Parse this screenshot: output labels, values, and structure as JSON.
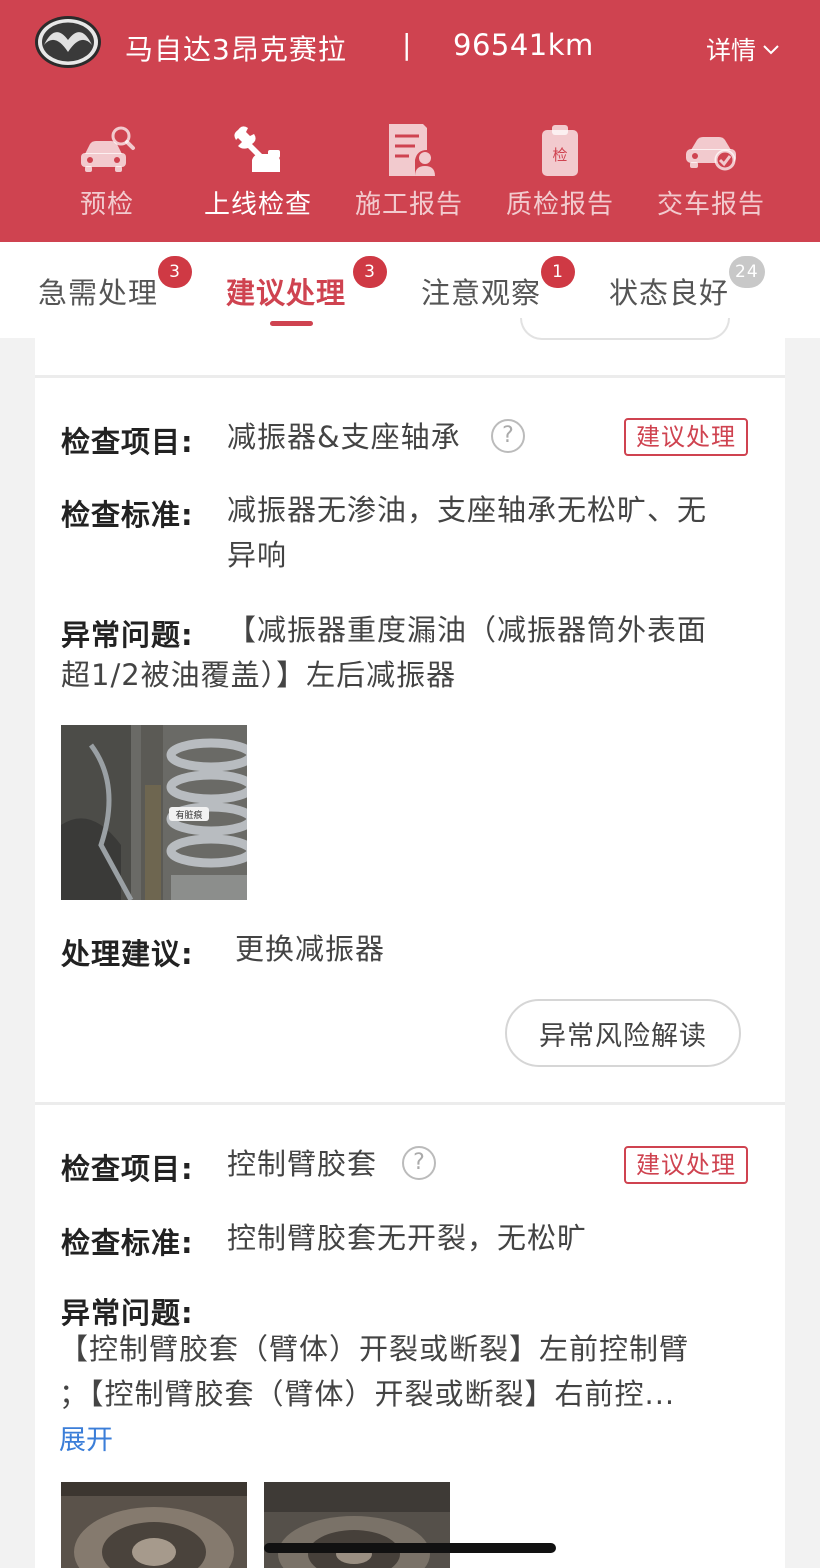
{
  "header": {
    "car_name": "马自达3昂克赛拉",
    "separator": "|",
    "mileage": "96541km",
    "detail": "详情",
    "bg_color": "#cf4350",
    "nav": [
      {
        "label": "预检",
        "icon": "car-search-icon"
      },
      {
        "label": "上线检查",
        "icon": "wrench-hand-icon"
      },
      {
        "label": "施工报告",
        "icon": "report-person-icon"
      },
      {
        "label": "质检报告",
        "icon": "clipboard-check-icon"
      },
      {
        "label": "交车报告",
        "icon": "car-check-icon"
      }
    ]
  },
  "tabs": [
    {
      "label": "急需处理",
      "count": "3"
    },
    {
      "label": "建议处理",
      "count": "3",
      "active": true
    },
    {
      "label": "注意观察",
      "count": "1"
    },
    {
      "label": "状态良好",
      "count": "24"
    }
  ],
  "labels": {
    "item": "检查项目:",
    "standard": "检查标准:",
    "problem": "异常问题:",
    "advice": "处理建议:"
  },
  "cards": [
    {
      "item": "减振器&支座轴承",
      "tag": "建议处理",
      "standard_line1": "减振器无渗油，支座轴承无松旷、无",
      "standard_line2": "异响",
      "problem_line1": "【减振器重度漏油（减振器筒外表面",
      "problem_line2": "超1/2被油覆盖）】左后减振器",
      "advice": "更换减振器",
      "photo_label": "有脏痕",
      "risk_button": "异常风险解读"
    },
    {
      "item": "控制臂胶套",
      "tag": "建议处理",
      "standard": "控制臂胶套无开裂，无松旷",
      "problem_line1": "【控制臂胶套（臂体）开裂或断裂】左前控制臂",
      "problem_line2": "；【控制臂胶套（臂体）开裂或断裂】右前控...",
      "expand": "展开"
    }
  ]
}
